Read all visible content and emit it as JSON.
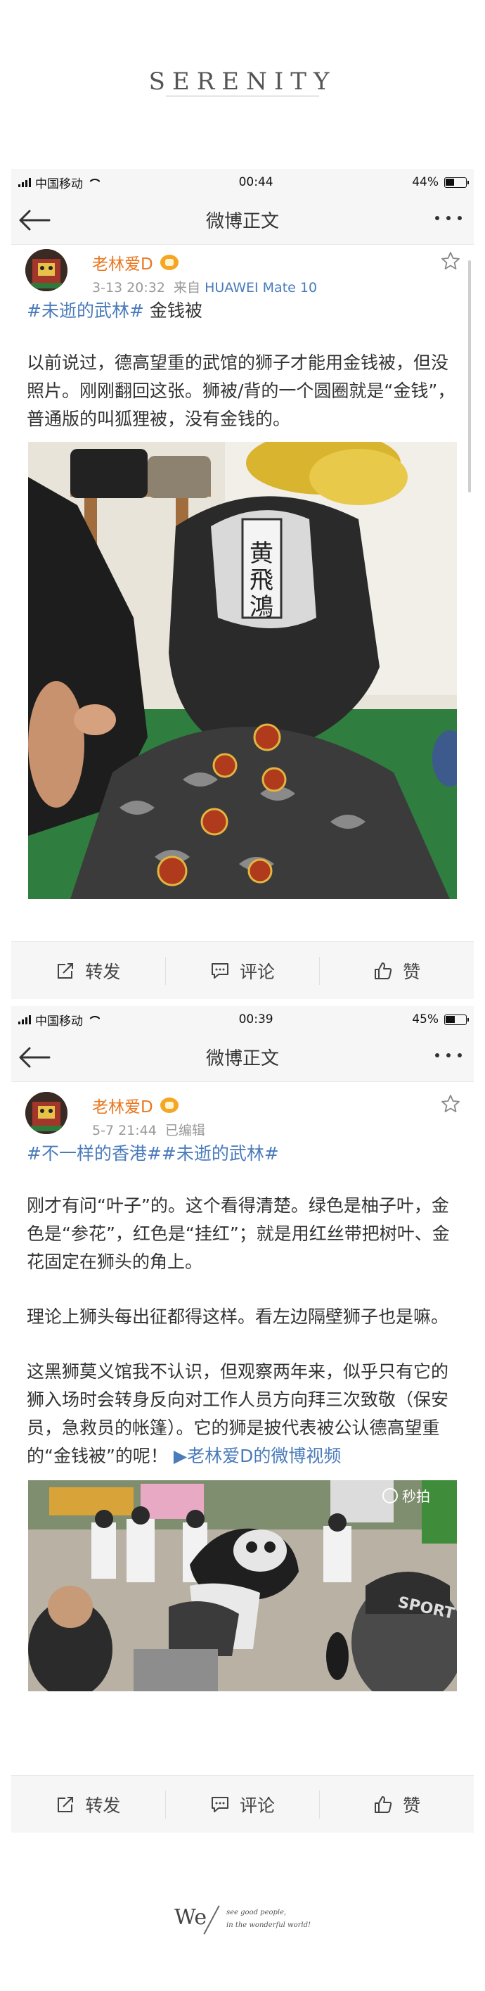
{
  "brand": "SERENITY",
  "screens": [
    {
      "status": {
        "carrier": "中国移动",
        "time": "00:44",
        "battery": "44%",
        "battery_level": 0.44
      },
      "nav_title": "微博正文",
      "post": {
        "username": "老林爱D",
        "date": "3-13 20:32",
        "source_prefix": "来自",
        "source": "HUAWEI Mate 10",
        "hashtag": "#未逝的武林#",
        "title_rest": " 金钱被",
        "paragraph": "以前说过，德高望重的武馆的狮子才能用金钱被，但没照片。刚刚翻回这张。狮被/背的一个圆圈就是“金钱”，普通版的叫狐狸被，没有金钱的。",
        "image_text": "黄飛鴻"
      },
      "actions": {
        "repost": "转发",
        "comment": "评论",
        "like": "赞"
      }
    },
    {
      "status": {
        "carrier": "中国移动",
        "time": "00:39",
        "battery": "45%",
        "battery_level": 0.45
      },
      "nav_title": "微博正文",
      "post": {
        "username": "老林爱D",
        "date": "5-7 21:44",
        "edited": "已编辑",
        "hashtag": "#不一样的香港##未逝的武林#",
        "paragraph1": "刚才有问“叶子”的。这个看得清楚。绿色是柚子叶，金色是“参花”，红色是“挂红”；就是用红丝带把树叶、金花固定在狮头的角上。",
        "paragraph2": "理论上狮头每出征都得这样。看左边隔壁狮子也是嘛。",
        "paragraph3": "这黑狮莫义馆我不认识，但观察两年来，似乎只有它的狮入场时会转身反向对工作人员方向拜三次致敬（保安员，急救员的帐篷）。它的狮是披代表被公认德高望重的“金钱被”的呢！",
        "video_link": "老林爱D的微博视频",
        "image_badge": "秒拍",
        "image_text": "SPORT"
      },
      "actions": {
        "repost": "转发",
        "comment": "评论",
        "like": "赞"
      }
    }
  ],
  "footer": {
    "mark": "We",
    "line1": "see good people,",
    "line2": "in the wonderful world!"
  }
}
